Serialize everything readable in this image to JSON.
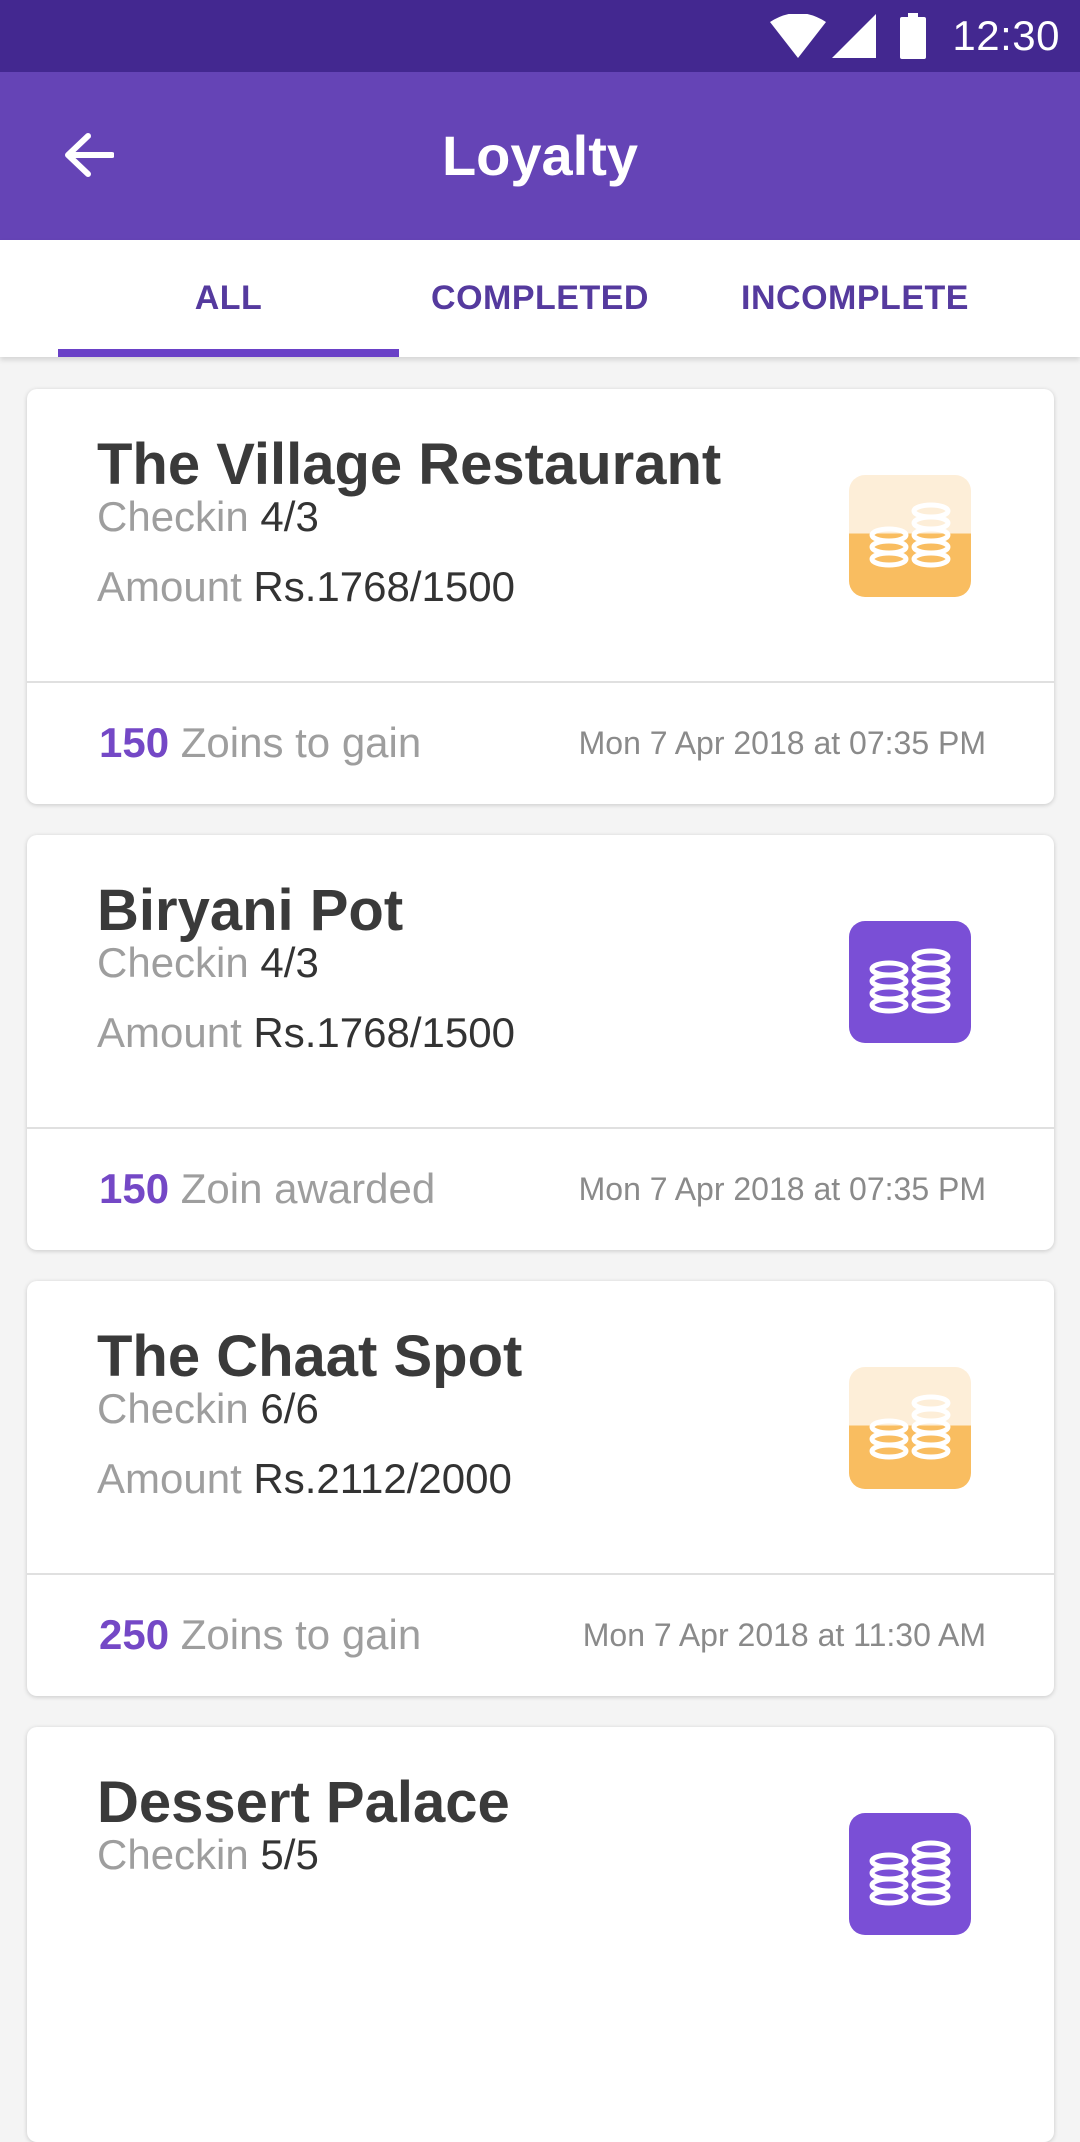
{
  "status_bar": {
    "time": "12:30",
    "icons": [
      "wifi-icon",
      "signal-icon",
      "battery-icon"
    ]
  },
  "app_bar": {
    "title": "Loyalty",
    "back_icon": "arrow-left-icon"
  },
  "tabs": [
    {
      "label": "ALL",
      "selected": true
    },
    {
      "label": "COMPLETED",
      "selected": false
    },
    {
      "label": "INCOMPLETE",
      "selected": false
    }
  ],
  "colors": {
    "status_bar": "#432890",
    "app_bar": "#6544b6",
    "accent": "#7448c6",
    "badge_orange": "#f9bd60",
    "badge_purple": "#7a4fd6"
  },
  "cards": [
    {
      "name": "The Village Restaurant",
      "checkin_label": "Checkin",
      "checkin_value": "4/3",
      "amount_label": "Amount",
      "amount_value": "Rs.1768/1500",
      "points": "150",
      "points_text": "Zoins to gain",
      "date": "Mon 7 Apr 2018 at 07:35 PM",
      "badge_icon": "coins-icon",
      "badge_style": "orange"
    },
    {
      "name": "Biryani Pot",
      "checkin_label": "Checkin",
      "checkin_value": "4/3",
      "amount_label": "Amount",
      "amount_value": "Rs.1768/1500",
      "points": "150",
      "points_text": "Zoin awarded",
      "date": "Mon 7 Apr 2018 at 07:35 PM",
      "badge_icon": "coins-icon",
      "badge_style": "purple"
    },
    {
      "name": "The Chaat Spot",
      "checkin_label": "Checkin",
      "checkin_value": "6/6",
      "amount_label": "Amount",
      "amount_value": "Rs.2112/2000",
      "points": "250",
      "points_text": "Zoins to gain",
      "date": "Mon 7 Apr 2018 at 11:30 AM",
      "badge_icon": "coins-icon",
      "badge_style": "orange"
    },
    {
      "name": "Dessert Palace",
      "checkin_label": "Checkin",
      "checkin_value": "5/5",
      "badge_icon": "coins-icon",
      "badge_style": "purple"
    }
  ]
}
